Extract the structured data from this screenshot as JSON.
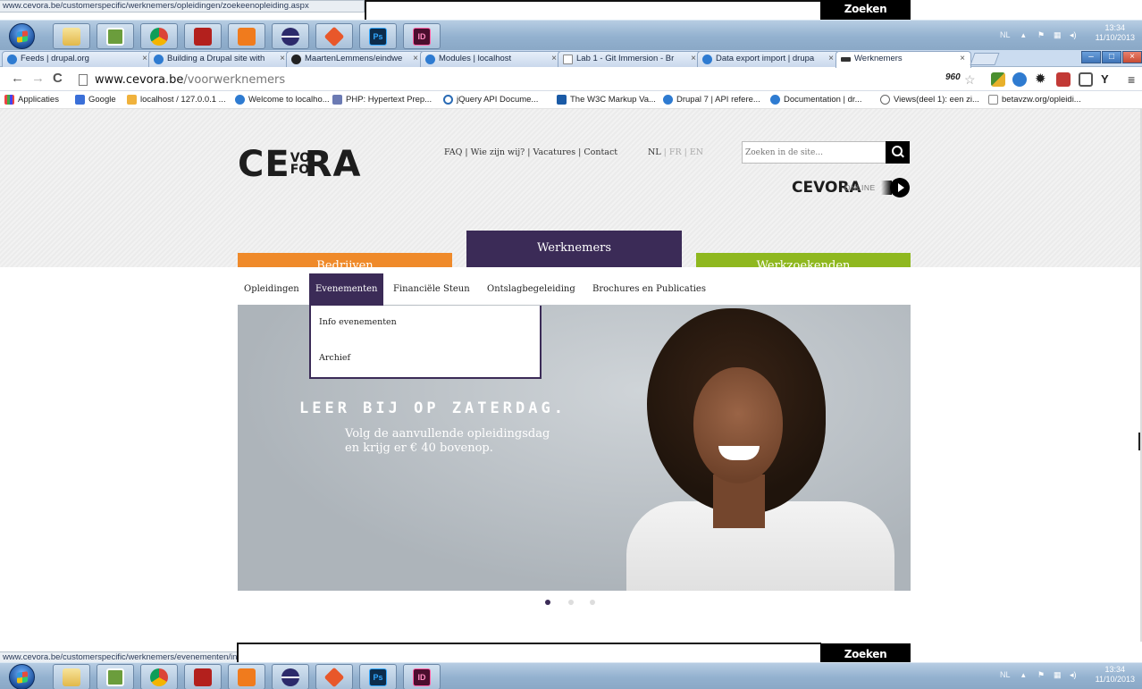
{
  "top_ghost": {
    "status_url": "www.cevora.be/customerspecific/werknemers/opleidingen/zoekeenopleiding.aspx",
    "zoeken_label": "Zoeken"
  },
  "bottom_ghost": {
    "status_url": "www.cevora.be/customerspecific/werknemers/evenementen/infoevenementen.aspx",
    "zoeken_label": "Zoeken"
  },
  "taskbar": {
    "apps": [
      "start-orb",
      "folder-icon",
      "notepad-icon",
      "chrome-icon",
      "filezilla-icon",
      "xampp-icon",
      "eclipse-icon",
      "git-icon",
      "photoshop-icon",
      "indesign-icon"
    ],
    "ps_label": "Ps",
    "id_label": "ID",
    "tray_lang": "NL",
    "time": "13:34",
    "date": "11/10/2013"
  },
  "tabs": [
    {
      "label": "Feeds | drupal.org"
    },
    {
      "label": "Building a Drupal site with"
    },
    {
      "label": "MaartenLemmens/eindwe"
    },
    {
      "label": "Modules | localhost"
    },
    {
      "label": "Lab 1 - Git Immersion - Br"
    },
    {
      "label": "Data export import | drupa"
    },
    {
      "label": "Werknemers"
    }
  ],
  "toolbar": {
    "url_host": "www.cevora.be",
    "url_path": "/voorwerknemers"
  },
  "bookmarks": [
    {
      "label": "Applicaties"
    },
    {
      "label": "Google"
    },
    {
      "label": "localhost / 127.0.0.1 ..."
    },
    {
      "label": "Welcome to localho..."
    },
    {
      "label": "PHP: Hypertext Prep..."
    },
    {
      "label": "jQuery API Docume..."
    },
    {
      "label": "The W3C Markup Va..."
    },
    {
      "label": "Drupal 7 | API refere..."
    },
    {
      "label": "Documentation | dr..."
    },
    {
      "label": "Views(deel 1): een zi..."
    },
    {
      "label": "betavzw.org/opleidi..."
    }
  ],
  "site": {
    "logo_ce": "CE",
    "logo_vo": "VO",
    "logo_fo": "FO",
    "logo_ra": "RA",
    "top_links": "FAQ | Wie zijn wij? | Vacatures | Contact",
    "lang_nl": "NL",
    "lang_fr": "| FR",
    "lang_en": "| EN",
    "search_placeholder": "Zoeken in de site...",
    "online_logo": "CEVORA",
    "online_label": "ONLINE",
    "blocks": {
      "bedrijven": "Bedrijven",
      "werknemers": "Werknemers",
      "werkzoekenden": "Werkzoekenden"
    },
    "menu": [
      {
        "label": "Opleidingen"
      },
      {
        "label": "Evenementen"
      },
      {
        "label": "Financiële Steun"
      },
      {
        "label": "Ontslagbegeleiding"
      },
      {
        "label": "Brochures en Publicaties"
      }
    ],
    "dropdown": [
      {
        "label": "Info evenementen"
      },
      {
        "label": "Archief"
      }
    ],
    "banner": {
      "tagline": "LEER BIJ OP ZATERDAG.",
      "sub_line1": "Volg de aanvullende opleidingsdag",
      "sub_line2": "en krijg er € 40 bovenop."
    },
    "slide_count": 3,
    "active_slide": 1
  },
  "colors": {
    "orange": "#ef8a2a",
    "purple": "#3b2b57",
    "green": "#8fb81f"
  }
}
